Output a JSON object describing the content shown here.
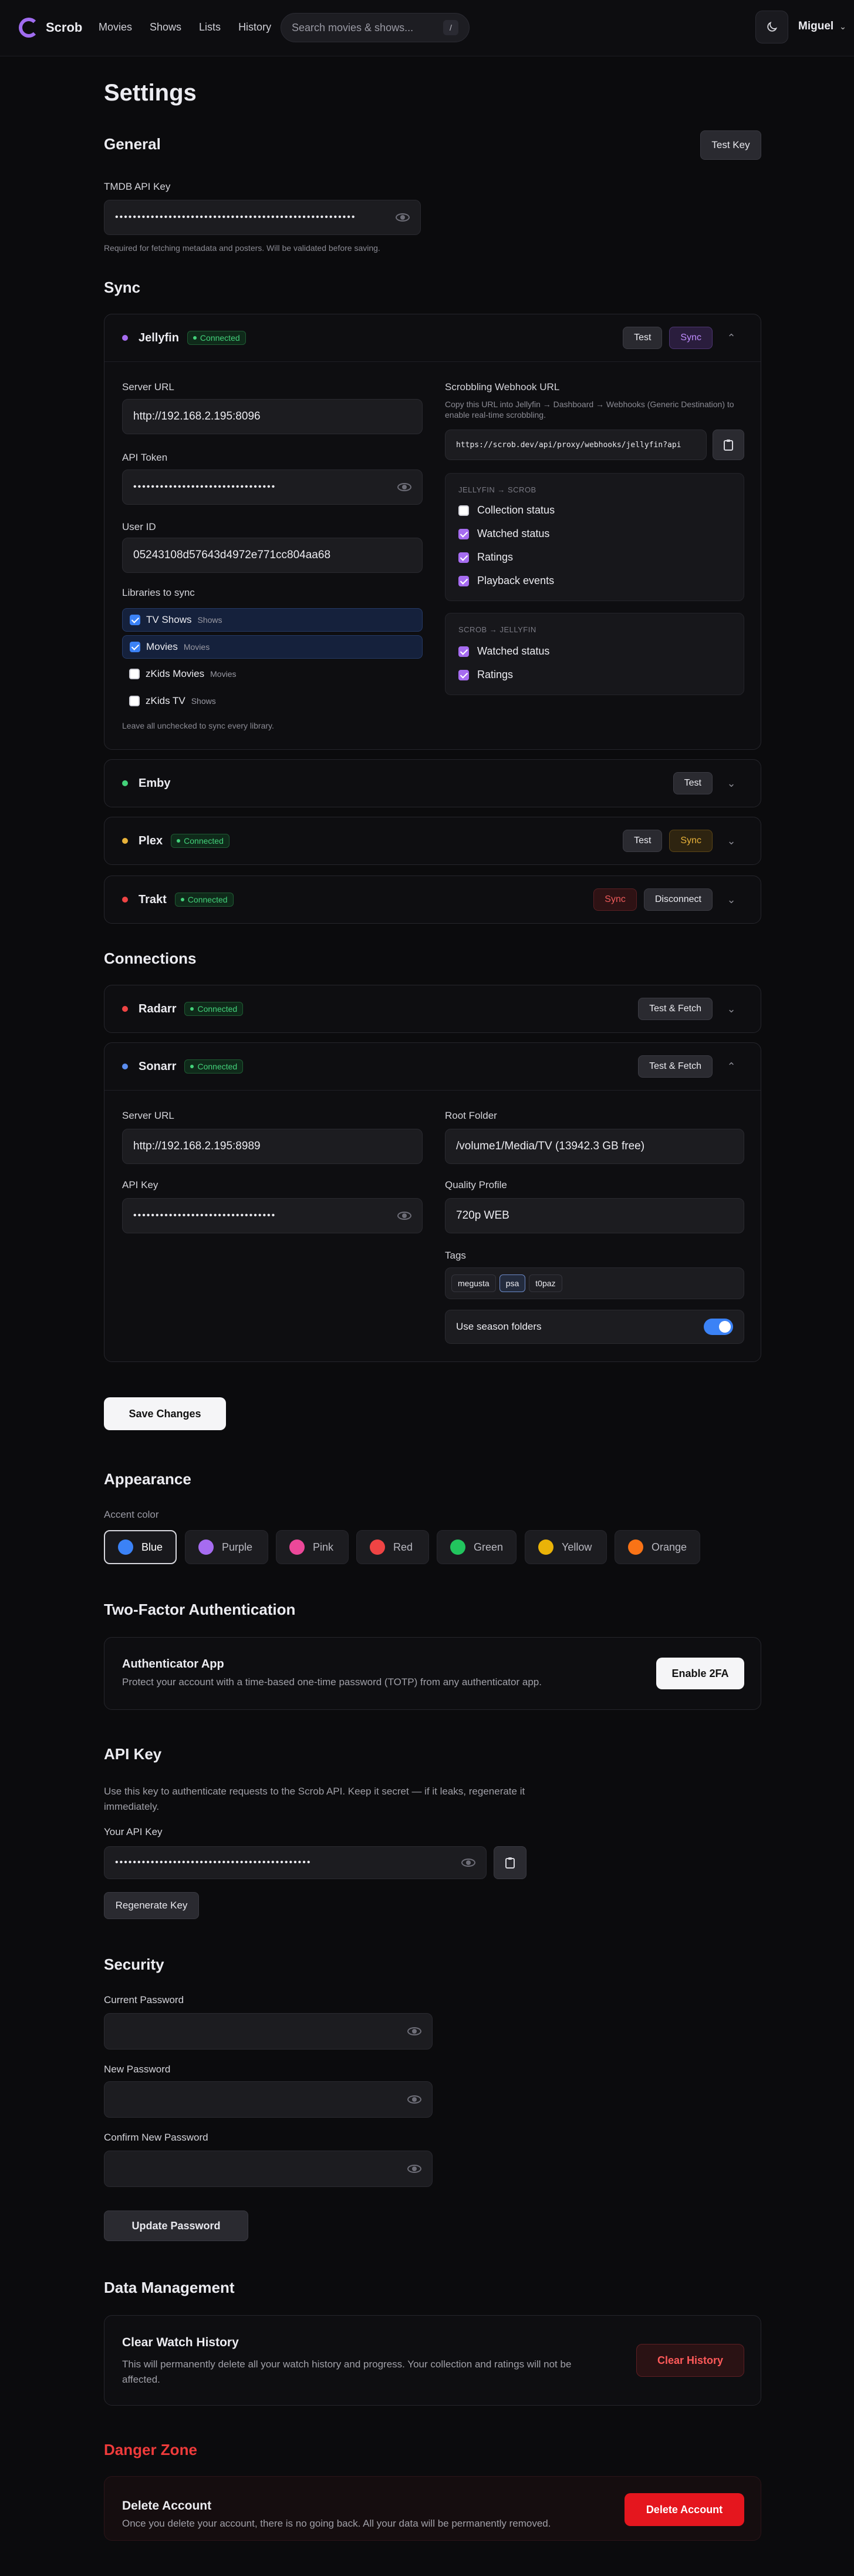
{
  "app": {
    "name": "Scrob",
    "user": "Miguel"
  },
  "nav": [
    "Movies",
    "Shows",
    "Lists",
    "History"
  ],
  "search": {
    "placeholder": "Search movies & shows...",
    "shortcut": "/"
  },
  "page_title": "Settings",
  "general": {
    "heading": "General",
    "test_key": "Test Key",
    "tmdb_label": "TMDB API Key",
    "tmdb_value": "••••••••••••••••••••••••••••••••••••••••••••••••••••••",
    "tmdb_help": "Required for fetching metadata and posters. Will be validated before saving."
  },
  "sync": {
    "heading": "Sync",
    "jellyfin": {
      "name": "Jellyfin",
      "status": "Connected",
      "dot_color": "#a66cf0",
      "test": "Test",
      "sync": "Sync",
      "server_url_label": "Server URL",
      "server_url": "http://192.168.2.195:8096",
      "api_token_label": "API Token",
      "api_token": "••••••••••••••••••••••••••••••••",
      "user_id_label": "User ID",
      "user_id": "05243108d57643d4972e771cc804aa68",
      "libraries_label": "Libraries to sync",
      "libraries": [
        {
          "name": "TV Shows",
          "type": "Shows",
          "checked": true
        },
        {
          "name": "Movies",
          "type": "Movies",
          "checked": true
        },
        {
          "name": "zKids Movies",
          "type": "Movies",
          "checked": false
        },
        {
          "name": "zKids TV",
          "type": "Shows",
          "checked": false
        }
      ],
      "libraries_help": "Leave all unchecked to sync every library.",
      "webhook_label": "Scrobbling Webhook URL",
      "webhook_help": "Copy this URL into Jellyfin → Dashboard → Webhooks (Generic Destination) to enable real-time scrobbling.",
      "webhook_url": "https://scrob.dev/api/proxy/webhooks/jellyfin?api",
      "import_title": "JELLYFIN → SCROB",
      "import_items": [
        {
          "label": "Collection status",
          "checked": false
        },
        {
          "label": "Watched status",
          "checked": true
        },
        {
          "label": "Ratings",
          "checked": true
        },
        {
          "label": "Playback events",
          "checked": true
        }
      ],
      "export_title": "SCROB → JELLYFIN",
      "export_items": [
        {
          "label": "Watched status",
          "checked": true
        },
        {
          "label": "Ratings",
          "checked": true
        }
      ]
    },
    "emby": {
      "name": "Emby",
      "dot_color": "#43d17a",
      "test": "Test"
    },
    "plex": {
      "name": "Plex",
      "status": "Connected",
      "dot_color": "#e8b23a",
      "test": "Test",
      "sync": "Sync"
    },
    "trakt": {
      "name": "Trakt",
      "status": "Connected",
      "dot_color": "#ef4444",
      "sync": "Sync",
      "disconnect": "Disconnect"
    }
  },
  "connections": {
    "heading": "Connections",
    "radarr": {
      "name": "Radarr",
      "status": "Connected",
      "dot_color": "#ef4444",
      "action": "Test & Fetch"
    },
    "sonarr": {
      "name": "Sonarr",
      "status": "Connected",
      "dot_color": "#5b8def",
      "action": "Test & Fetch",
      "server_url_label": "Server URL",
      "server_url": "http://192.168.2.195:8989",
      "api_key_label": "API Key",
      "api_key": "••••••••••••••••••••••••••••••••",
      "root_folder_label": "Root Folder",
      "root_folder": "/volume1/Media/TV (13942.3 GB free)",
      "quality_label": "Quality Profile",
      "quality": "720p WEB",
      "tags_label": "Tags",
      "tags": [
        "megusta",
        "psa",
        "t0paz"
      ],
      "season_folders": "Use season folders"
    }
  },
  "save_changes": "Save Changes",
  "appearance": {
    "heading": "Appearance",
    "accent_label": "Accent color",
    "colors": [
      {
        "name": "Blue",
        "hex": "#3b82f6"
      },
      {
        "name": "Purple",
        "hex": "#a66cf0"
      },
      {
        "name": "Pink",
        "hex": "#ec4899"
      },
      {
        "name": "Red",
        "hex": "#ef4444"
      },
      {
        "name": "Green",
        "hex": "#22c55e"
      },
      {
        "name": "Yellow",
        "hex": "#eab308"
      },
      {
        "name": "Orange",
        "hex": "#f97316"
      }
    ]
  },
  "twofa": {
    "heading": "Two-Factor Authentication",
    "title": "Authenticator App",
    "desc": "Protect your account with a time-based one-time password (TOTP) from any authenticator app.",
    "button": "Enable 2FA"
  },
  "apikey": {
    "heading": "API Key",
    "desc": "Use this key to authenticate requests to the Scrob API. Keep it secret — if it leaks, regenerate it immediately.",
    "label": "Your API Key",
    "value": "••••••••••••••••••••••••••••••••••••••••••••",
    "regenerate": "Regenerate Key"
  },
  "security": {
    "heading": "Security",
    "current": "Current Password",
    "new": "New Password",
    "confirm": "Confirm New Password",
    "button": "Update Password"
  },
  "data": {
    "heading": "Data Management",
    "title": "Clear Watch History",
    "desc": "This will permanently delete all your watch history and progress. Your collection and ratings will not be affected.",
    "button": "Clear History"
  },
  "danger": {
    "heading": "Danger Zone",
    "title": "Delete Account",
    "desc": "Once you delete your account, there is no going back. All your data will be permanently removed.",
    "button": "Delete Account"
  }
}
